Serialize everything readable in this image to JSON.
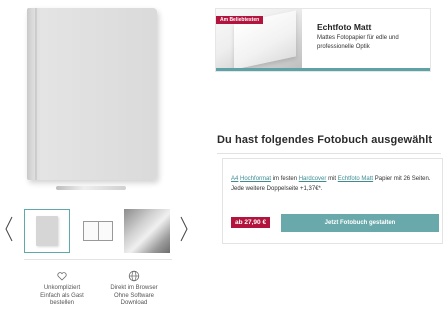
{
  "product": {
    "pen_label": "——————",
    "thumbnails": [
      "cover-view",
      "open-book-view",
      "photo-view"
    ]
  },
  "features": [
    {
      "icon": "heart-hand-icon",
      "lines": [
        "Unkompliziert",
        "Einfach als Gast",
        "bestellen"
      ]
    },
    {
      "icon": "globe-icon",
      "lines": [
        "Direkt im Browser",
        "Ohne Software",
        "Download"
      ]
    }
  ],
  "banner": {
    "badge": "Am Beliebtesten",
    "title": "Echtfoto Matt",
    "description": "Mattes Fotopapier für edle und professionelle Optik"
  },
  "summary": {
    "heading": "Du hast folgendes Fotobuch ausgewählt",
    "format": "A4",
    "orientation": "Hochformat",
    "text_1": "im festen",
    "cover": "Hardcover",
    "text_2": "mit",
    "paper": "Echtfoto Matt",
    "text_3": "Papier mit 26 Seiten. Jede weitere Doppelseite +1,37€*.",
    "price": "ab 27,90 €",
    "cta": "Jetzt Fotobuch gestalten"
  },
  "colors": {
    "accent": "#6aa9ab",
    "brand_red": "#b3143d"
  }
}
